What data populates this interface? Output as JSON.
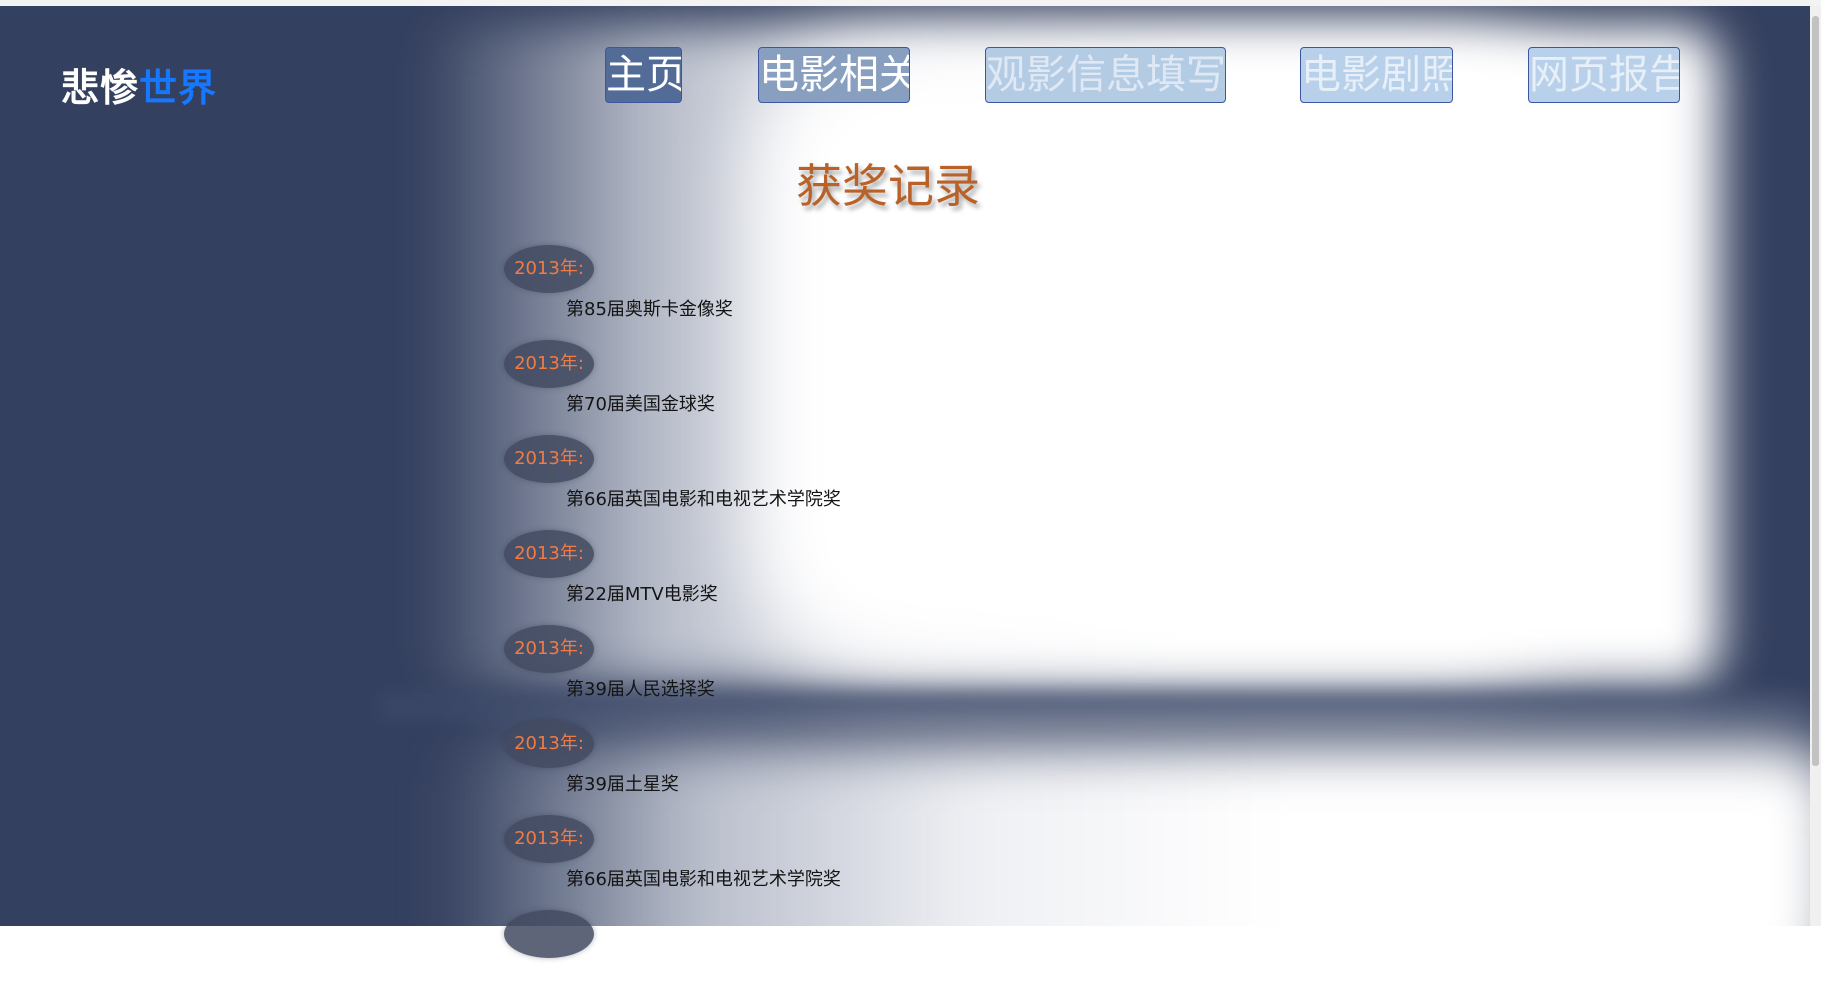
{
  "logo": {
    "part1": "悲惨",
    "part2": "世界"
  },
  "nav": [
    "主页",
    "电影相关",
    "观影信息填写",
    "电影剧照",
    "网页报告"
  ],
  "page_title": "获奖记录",
  "awards": [
    {
      "year": "2013年:",
      "name": "第85届奥斯卡金像奖"
    },
    {
      "year": "2013年:",
      "name": "第70届美国金球奖"
    },
    {
      "year": "2013年:",
      "name": "第66届英国电影和电视艺术学院奖"
    },
    {
      "year": "2013年:",
      "name": "第22届MTV电影奖"
    },
    {
      "year": "2013年:",
      "name": "第39届人民选择奖"
    },
    {
      "year": "2013年:",
      "name": "第39届土星奖"
    },
    {
      "year": "2013年:",
      "name": "第66届英国电影和电视艺术学院奖"
    }
  ],
  "colors": {
    "background_dark": "#34405f",
    "logo_accent": "#1677ff",
    "title": "#b86128",
    "year_text": "#f07b45"
  }
}
